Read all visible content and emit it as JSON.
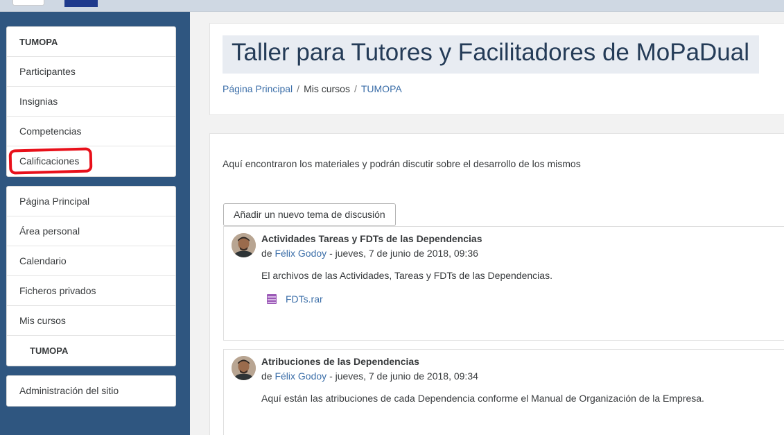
{
  "sidebar": {
    "course_block": {
      "items": [
        {
          "label": "TUMOPA"
        },
        {
          "label": "Participantes"
        },
        {
          "label": "Insignias"
        },
        {
          "label": "Competencias"
        },
        {
          "label": "Calificaciones"
        }
      ]
    },
    "nav_block": {
      "items": [
        {
          "label": "Página Principal"
        },
        {
          "label": "Área personal"
        },
        {
          "label": "Calendario"
        },
        {
          "label": "Ficheros privados"
        },
        {
          "label": "Mis cursos"
        },
        {
          "label": "TUMOPA"
        }
      ]
    },
    "admin_block": {
      "items": [
        {
          "label": "Administración del sitio"
        }
      ]
    },
    "annotation_color": "#e8101a"
  },
  "header": {
    "title": "Taller para Tutores y Facilitadores de MoPaDual",
    "breadcrumb": [
      {
        "label": "Página Principal"
      },
      {
        "label": "Mis cursos"
      },
      {
        "label": "TUMOPA"
      }
    ],
    "separator": "/"
  },
  "forum": {
    "intro": "Aquí encontraron los materiales y podrán discutir sobre el desarrollo de los mismos",
    "add_button": "Añadir un nuevo tema de discusión",
    "posts": [
      {
        "subject": "Actividades Tareas y FDTs de las Dependencias",
        "by": "de",
        "author": "Félix Godoy",
        "date": "- jueves, 7 de junio de 2018, 09:36",
        "body": "El archivos de las Actividades, Tareas y FDTs de las Dependencias.",
        "attachment": {
          "name": "FDTs.rar",
          "icon": "archive-file-icon"
        }
      },
      {
        "subject": "Atribuciones de las Dependencias",
        "by": "de",
        "author": "Félix Godoy",
        "date": "- jueves, 7 de junio de 2018, 09:34",
        "body": "Aquí están las atribuciones de cada Dependencia conforme el Manual de Organización de la Empresa."
      }
    ]
  },
  "colors": {
    "sidebar_bg": "#2f5680",
    "link": "#3b6ea8",
    "title_text": "#243b57"
  }
}
